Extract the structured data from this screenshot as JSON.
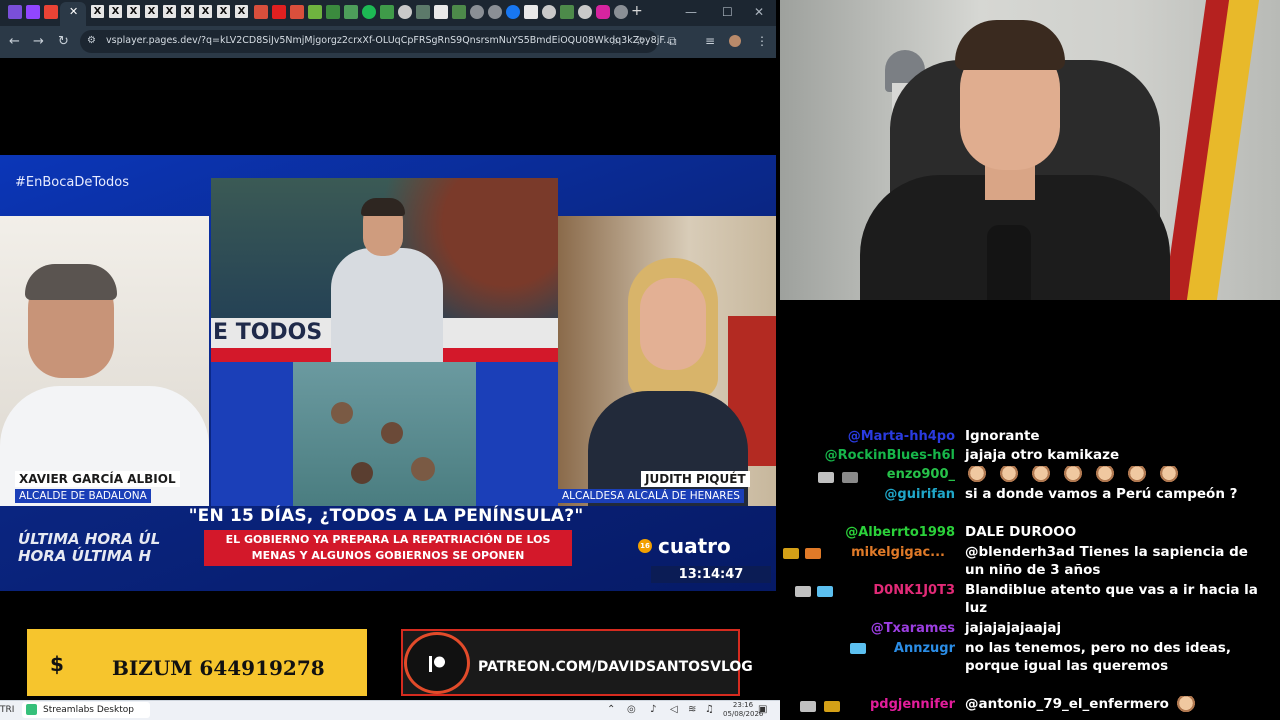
{
  "browser": {
    "url": "vsplayer.pages.dev/?q=kLV2CD8SiJv5NmjMjgorgz2crxXf-OLUqCpFRSgRnS9QnsrsmNuYS5BmdEiOQU08Wkdq3kZoy8jF...",
    "new_tab": "+",
    "active_tab_close": "✕",
    "tab_x_label": "X",
    "controls": {
      "minimize": "—",
      "maximize": "☐",
      "close": "✕"
    }
  },
  "tv": {
    "hashtag": "#EnBocaDeTodos",
    "guest_left_name": "XAVIER GARCÍA ALBIOL",
    "guest_left_role": "ALCALDE DE BADALONA",
    "guest_right_name": "JUDITH PIQUÉT",
    "guest_right_role": "ALCALDESA ALCALÁ DE HENARES",
    "studio_backdrop": "E TODOS   BOCA",
    "headline": "\"EN 15 DÍAS, ¿TODOS A LA PENÍNSULA?\"",
    "subhead_line1": "EL GOBIERNO YA PREPARA LA REPATRIACIÓN DE LOS",
    "subhead_line2": "MENAS Y ALGUNOS GOBIERNOS SE OPONEN",
    "ticker_top": "ÚLTIMA HORA   ÚL",
    "ticker_bottom": "HORA   ÚLTIMA H",
    "channel": "cuatro",
    "channel_badge": "16",
    "clock": "13:14:47"
  },
  "ads": {
    "bizum_symbol": "$",
    "bizum_text": "BIZUM 644919278",
    "patreon_text": "PATREON.COM/DAVIDSANTOSVLOG"
  },
  "taskbar": {
    "left_label": "TRI",
    "app_label": "Streamlabs Desktop",
    "time": "23:16",
    "date": "05/08/2026"
  },
  "chat": {
    "messages": [
      {
        "name": "@Marta-hh4po",
        "color": "#2a3be0",
        "text": "Ignorante"
      },
      {
        "name": "@RockinBlues-h6l",
        "color": "#17b64a",
        "text": "jajaja otro kamikaze"
      },
      {
        "name": "enzo900_",
        "color": "#27c24a",
        "text": ""
      },
      {
        "name": "@guirifan",
        "color": "#20a7c9",
        "text": "si a donde vamos a Perú campeón ?"
      },
      {
        "name": "@Alberrto1998",
        "color": "#2bd13a",
        "text": "DALE DUROOO"
      },
      {
        "name": "mikelgigac...",
        "color": "#e07a28",
        "text": "@blenderh3ad Tienes la sapiencia de un niño de 3 años"
      },
      {
        "name": "D0NK1J0T3",
        "color": "#e22a77",
        "text": "Blandiblue atento que vas a ir hacia la luz"
      },
      {
        "name": "@Txarames",
        "color": "#9b3ee0",
        "text": "jajajajajaajaj"
      },
      {
        "name": "Annzugr",
        "color": "#2b8de6",
        "text": "no las tenemos, pero no des ideas, porque igual las queremos"
      },
      {
        "name": "pdgjennifer",
        "color": "#e21d9b",
        "text": "@antonio_79_el_enfermero"
      }
    ]
  },
  "colors": {
    "tv_blue": "#0a2ea6",
    "headline_red": "#d3182a",
    "bizum_yellow": "#f6c52d",
    "patreon_red": "#d62b1f"
  }
}
